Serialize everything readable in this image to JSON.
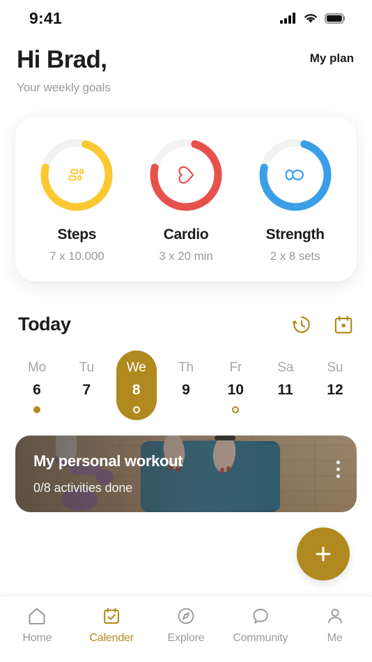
{
  "theme": {
    "gold": "#B08A1E",
    "yellow": "#FBC832",
    "red": "#E8504C",
    "blue": "#3B9FE8",
    "track": "#F2F2F2",
    "muted": "#9a9a9a",
    "ink": "#1c1c1c"
  },
  "statusbar": {
    "time": "9:41",
    "icons": [
      "cellular-signal-icon",
      "wifi-icon",
      "battery-icon"
    ]
  },
  "header": {
    "greeting": "Hi Brad,",
    "subgreeting": "Your weekly goals",
    "my_plan_label": "My plan"
  },
  "goals": [
    {
      "title": "Steps",
      "sub": "7 x 10.000",
      "icon": "footprints-icon",
      "color": "#FBC832",
      "progress": 0.74
    },
    {
      "title": "Cardio",
      "sub": "3 x 20 min",
      "icon": "heart-icon",
      "color": "#E8504C",
      "progress": 0.74
    },
    {
      "title": "Strength",
      "sub": "2 x 8 sets",
      "icon": "kettlebell-icon",
      "color": "#3B9FE8",
      "progress": 0.74
    }
  ],
  "today": {
    "title": "Today",
    "icons": [
      {
        "name": "history-icon",
        "label": "History"
      },
      {
        "name": "calendar-icon",
        "label": "Calendar"
      }
    ]
  },
  "week": [
    {
      "name": "Mo",
      "num": "6",
      "active": false,
      "dot": "filled"
    },
    {
      "name": "Tu",
      "num": "7",
      "active": false,
      "dot": "none"
    },
    {
      "name": "We",
      "num": "8",
      "active": true,
      "dot": "hollow"
    },
    {
      "name": "Th",
      "num": "9",
      "active": false,
      "dot": "none"
    },
    {
      "name": "Fr",
      "num": "10",
      "active": false,
      "dot": "hollow"
    },
    {
      "name": "Sa",
      "num": "11",
      "active": false,
      "dot": "none"
    },
    {
      "name": "Su",
      "num": "12",
      "active": false,
      "dot": "none"
    }
  ],
  "workout": {
    "title": "My personal workout",
    "subtitle": "0/8 activities done",
    "menu_icon": "kebab-menu-icon",
    "photo_description": "hands rolling a blue yoga mat on a wooden floor with purple dumbbells and a water bottle"
  },
  "fab": {
    "icon": "plus-icon",
    "label": "Add"
  },
  "bottom_nav": [
    {
      "label": "Home",
      "icon": "home-icon",
      "active": false
    },
    {
      "label": "Calender",
      "icon": "calendar-check-icon",
      "active": true
    },
    {
      "label": "Explore",
      "icon": "compass-icon",
      "active": false
    },
    {
      "label": "Community",
      "icon": "chat-bubble-icon",
      "active": false
    },
    {
      "label": "Me",
      "icon": "person-icon",
      "active": false
    }
  ]
}
